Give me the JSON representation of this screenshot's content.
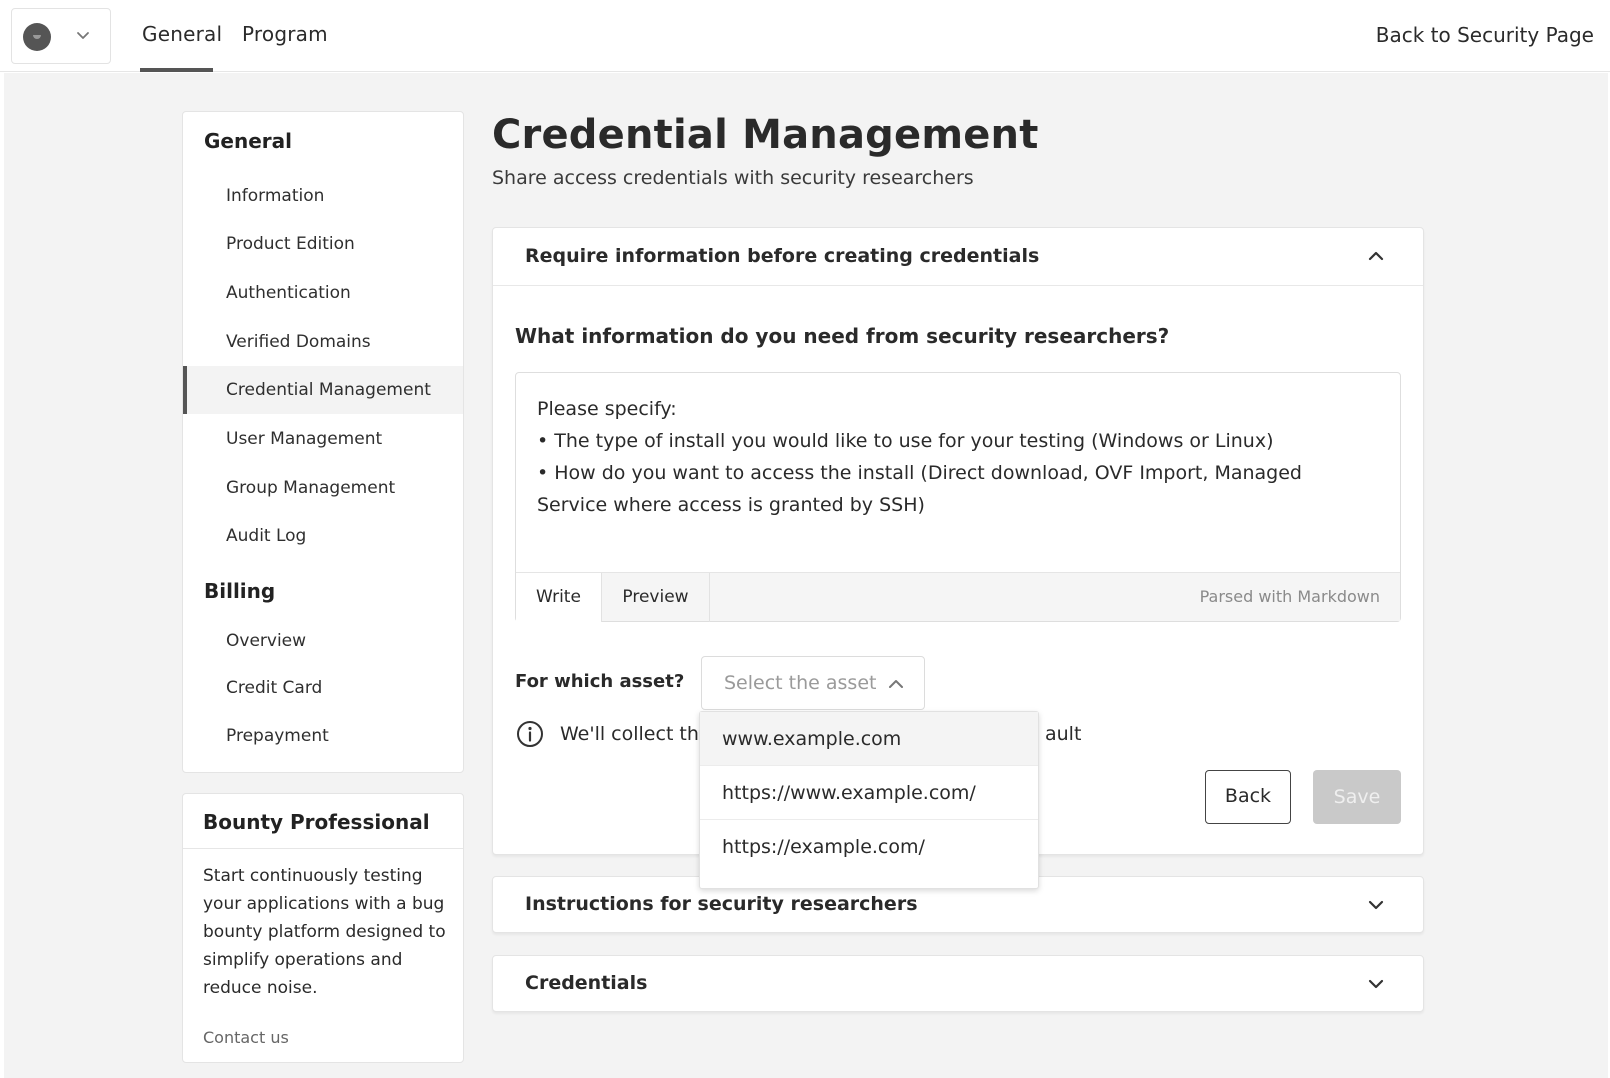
{
  "topbar": {
    "nav_tabs": [
      "General",
      "Program"
    ],
    "back_link": "Back to Security Page"
  },
  "sidebar": {
    "general_heading": "General",
    "general_items": [
      "Information",
      "Product Edition",
      "Authentication",
      "Verified Domains",
      "Credential Management",
      "User Management",
      "Group Management",
      "Audit Log"
    ],
    "active_item": "Credential Management",
    "billing_heading": "Billing",
    "billing_items": [
      "Overview",
      "Credit Card",
      "Prepayment"
    ]
  },
  "bounty_card": {
    "title": "Bounty Professional",
    "body": "Start continuously testing your applications with a bug bounty platform designed to simplify operations and reduce noise.",
    "link": "Contact us"
  },
  "main": {
    "title": "Credential Management",
    "subtitle": "Share access credentials with security researchers",
    "panels": [
      {
        "title": "Require information before creating credentials",
        "expanded": true
      },
      {
        "title": "Instructions for security researchers",
        "expanded": false
      },
      {
        "title": "Credentials",
        "expanded": false
      }
    ],
    "question": "What information do you need from security researchers?",
    "editor": {
      "text": "Please specify:\n• The type of install you would like to use for your testing (Windows or Linux)\n• How do you want to access the install (Direct download, OVF Import, Managed Service where access is granted by SSH)",
      "tab_write": "Write",
      "tab_preview": "Preview",
      "note": "Parsed with Markdown"
    },
    "asset": {
      "label": "For which asset?",
      "placeholder": "Select the asset",
      "options": [
        "www.example.com",
        "https://www.example.com/",
        "https://example.com/"
      ]
    },
    "info": {
      "text_visible_left": "We'll collect the",
      "text_visible_right": "ault"
    },
    "buttons": {
      "back": "Back",
      "save": "Save"
    }
  },
  "colors": {
    "page_bg": "#f3f3f3",
    "active_border": "#555555",
    "save_disabled": "#c9c9c9"
  }
}
